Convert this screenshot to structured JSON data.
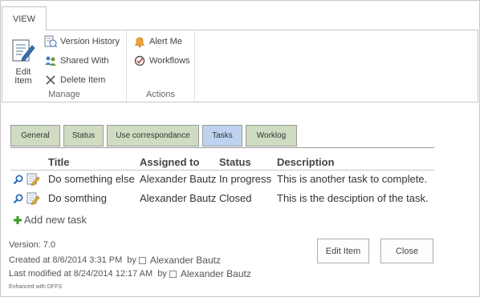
{
  "ribbon": {
    "tab_view": "VIEW",
    "manage": {
      "edit_item_line1": "Edit",
      "edit_item_line2": "Item",
      "version_history": "Version History",
      "shared_with": "Shared With",
      "delete_item": "Delete Item",
      "group_label": "Manage"
    },
    "actions": {
      "alert_me": "Alert Me",
      "workflows": "Workflows",
      "group_label": "Actions"
    }
  },
  "form_tabs": [
    {
      "label": "General",
      "active": false
    },
    {
      "label": "Status",
      "active": false
    },
    {
      "label": "Use correspondance",
      "active": false
    },
    {
      "label": "Tasks",
      "active": true
    },
    {
      "label": "Worklog",
      "active": false
    }
  ],
  "tasks": {
    "columns": [
      "Title",
      "Assigned to",
      "Status",
      "Description"
    ],
    "rows": [
      {
        "title": "Do something else",
        "assigned_to": "Alexander Bautz",
        "status": "In progress",
        "description": "This is another task to complete."
      },
      {
        "title": "Do somthing",
        "assigned_to": "Alexander Bautz",
        "status": "Closed",
        "description": "This is the desciption of the task."
      }
    ],
    "add_new": "Add new task"
  },
  "footer": {
    "version": "Version: 7.0",
    "created": "Created at 8/6/2014 3:31 PM",
    "modified": "Last modified at 8/24/2014 12:17 AM",
    "by": "by",
    "created_by": "Alexander Bautz",
    "modified_by": "Alexander Bautz",
    "enhanced": "Enhanced with DFFS"
  },
  "buttons": {
    "edit_item": "Edit Item",
    "close": "Close"
  },
  "colors": {
    "tab_inactive": "#cfdcc1",
    "tab_active": "#bdd3ef",
    "icon_blue": "#2a6fb5",
    "add_green": "#3a9a2a"
  }
}
